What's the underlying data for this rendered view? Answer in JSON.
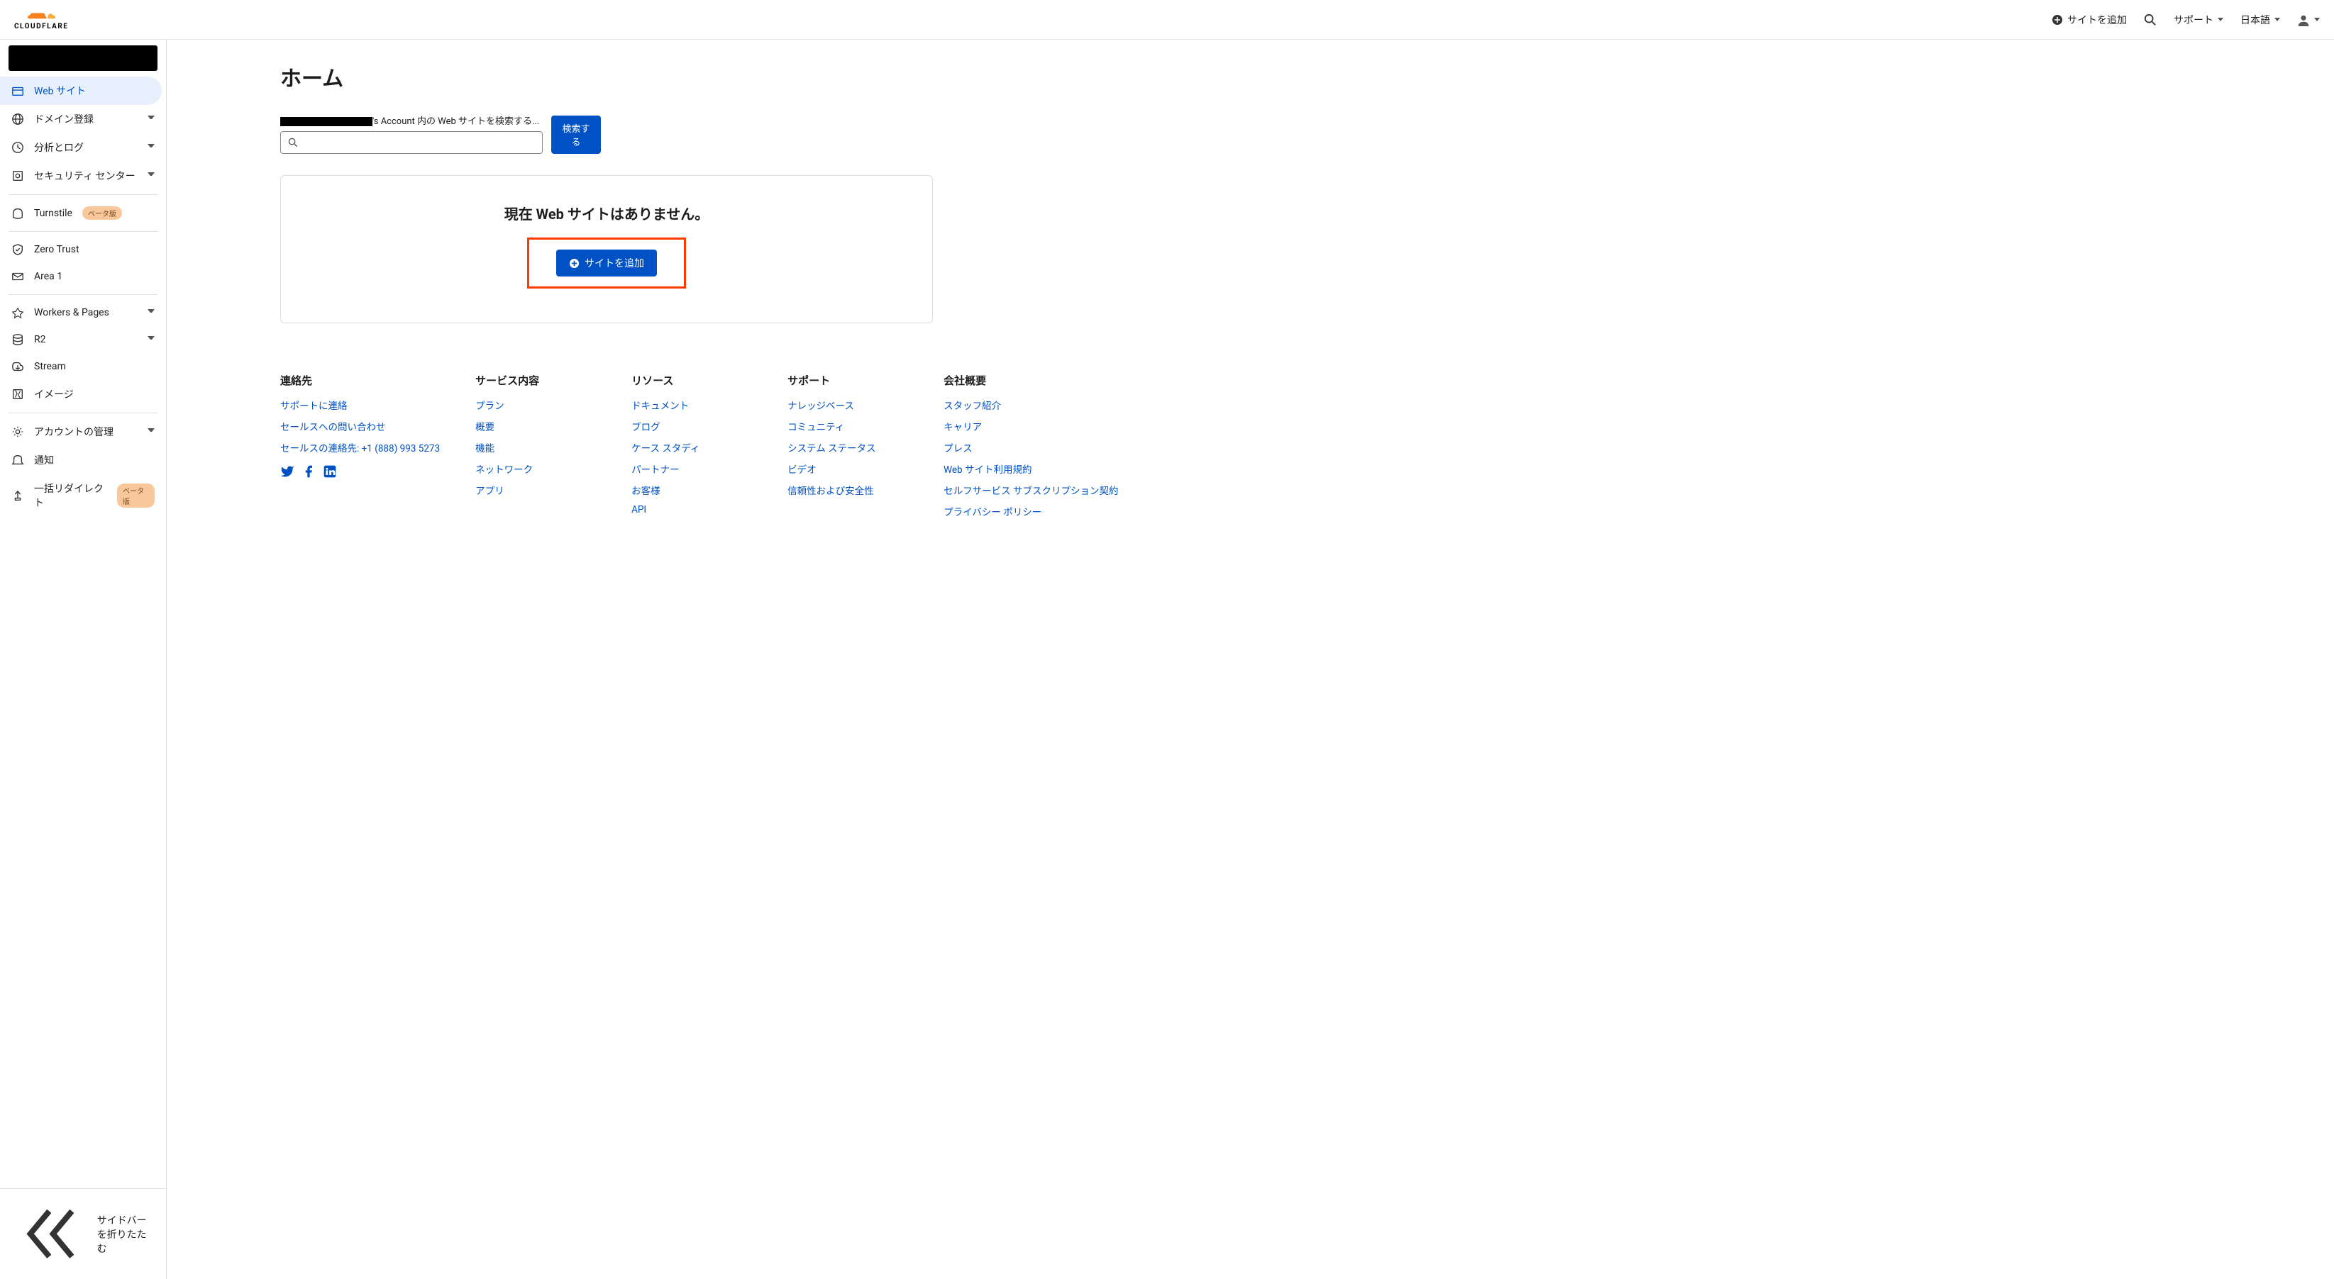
{
  "brand": "CLOUDFLARE",
  "header": {
    "add_site": "サイトを追加",
    "support": "サポート",
    "language": "日本語"
  },
  "sidebar": {
    "items": [
      {
        "label": "Web サイト",
        "active": true
      },
      {
        "label": "ドメイン登録",
        "dropdown": true
      },
      {
        "label": "分析とログ",
        "dropdown": true
      },
      {
        "label": "セキュリティ センター",
        "dropdown": true
      }
    ],
    "items2": [
      {
        "label": "Turnstile",
        "badge": "ベータ版"
      }
    ],
    "items3": [
      {
        "label": "Zero Trust"
      },
      {
        "label": "Area 1"
      }
    ],
    "items4": [
      {
        "label": "Workers & Pages",
        "dropdown": true
      },
      {
        "label": "R2",
        "dropdown": true
      },
      {
        "label": "Stream"
      },
      {
        "label": "イメージ"
      }
    ],
    "items5": [
      {
        "label": "アカウントの管理",
        "dropdown": true
      },
      {
        "label": "通知"
      },
      {
        "label": "一括リダイレクト",
        "badge": "ベータ版"
      }
    ],
    "collapse_label": "サイドバーを折りたたむ"
  },
  "page": {
    "title": "ホーム",
    "search_label_suffix": "'s Account 内の Web サイトを検索する...",
    "search_button": "検索する"
  },
  "empty": {
    "title": "現在 Web サイトはありません。",
    "add_button": "サイトを追加"
  },
  "footer": {
    "cols": [
      {
        "heading": "連絡先",
        "links": [
          "サポートに連絡",
          "セールスへの問い合わせ",
          "セールスの連絡先: +1 (888) 993 5273"
        ],
        "social": true
      },
      {
        "heading": "サービス内容",
        "links": [
          "プラン",
          "概要",
          "機能",
          "ネットワーク",
          "アプリ"
        ]
      },
      {
        "heading": "リソース",
        "links": [
          "ドキュメント",
          "ブログ",
          "ケース スタディ",
          "パートナー",
          "お客様",
          "API"
        ]
      },
      {
        "heading": "サポート",
        "links": [
          "ナレッジベース",
          "コミュニティ",
          "システム ステータス",
          "ビデオ",
          "信頼性および安全性"
        ]
      },
      {
        "heading": "会社概要",
        "links": [
          "スタッフ紹介",
          "キャリア",
          "プレス",
          "Web サイト利用規約",
          "セルフサービス サブスクリプション契約",
          "プライバシー ポリシー"
        ]
      }
    ]
  }
}
